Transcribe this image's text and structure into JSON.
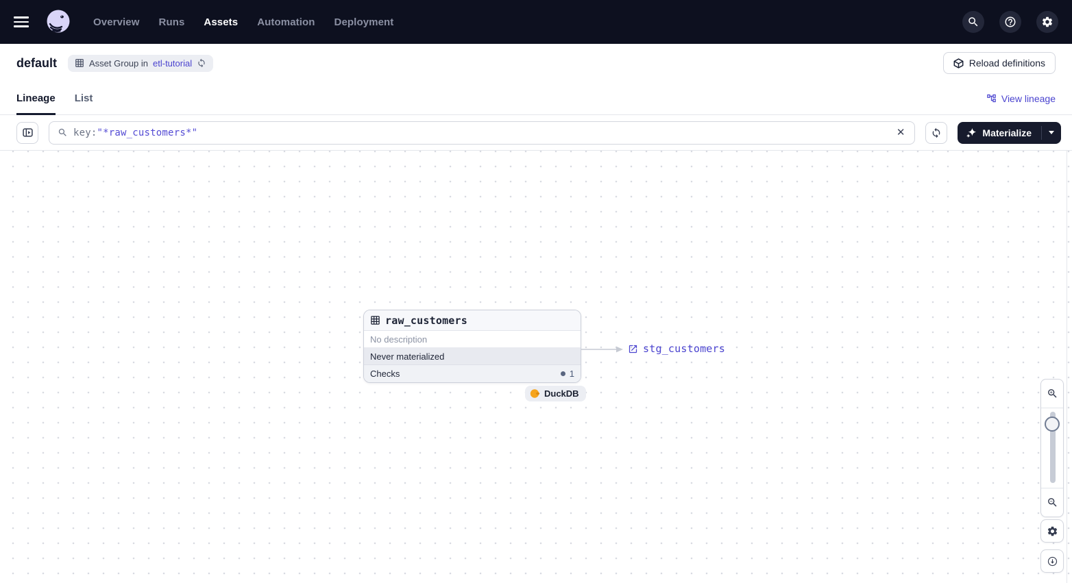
{
  "nav": {
    "items": [
      {
        "label": "Overview",
        "active": false
      },
      {
        "label": "Runs",
        "active": false
      },
      {
        "label": "Assets",
        "active": true
      },
      {
        "label": "Automation",
        "active": false
      },
      {
        "label": "Deployment",
        "active": false
      }
    ]
  },
  "header": {
    "title": "default",
    "badge_prefix": "Asset Group in",
    "badge_link": "etl-tutorial",
    "reload_label": "Reload definitions"
  },
  "tabs": {
    "lineage": "Lineage",
    "list": "List",
    "view_lineage": "View lineage"
  },
  "toolbar": {
    "search_prefix": "key:",
    "search_query": "\"*raw_customers*\"",
    "clear_glyph": "✕",
    "materialize_label": "Materialize"
  },
  "graph": {
    "node": {
      "title": "raw_customers",
      "description": "No description",
      "materialization_status": "Never materialized",
      "checks_label": "Checks",
      "checks_count": "1",
      "kind": "DuckDB"
    },
    "downstream_asset": "stg_customers"
  },
  "colors": {
    "nav_bg": "#0d101f",
    "accent_link": "#4a43cf",
    "dark_button": "#171b2d",
    "duckdb_orange": "#f6a41c",
    "status_row_bg": "#e8eaf0"
  }
}
